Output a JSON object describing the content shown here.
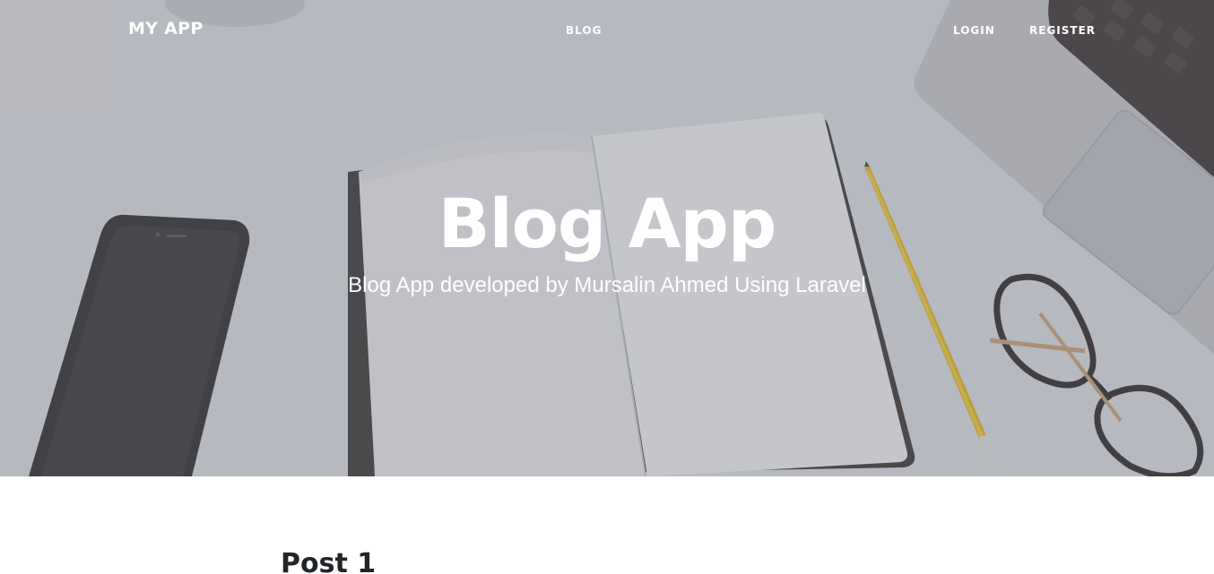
{
  "navbar": {
    "brand": "MY APP",
    "links": [
      {
        "label": "BLOG"
      },
      {
        "label": "LOGIN"
      },
      {
        "label": "REGISTER"
      }
    ]
  },
  "hero": {
    "title": "Blog App",
    "subtitle": "Blog App developed by Mursalin Ahmed Using Laravel"
  },
  "posts": [
    {
      "title": "Post 1"
    }
  ],
  "colors": {
    "overlay": "#6e7078",
    "text_light": "#ffffff",
    "text_dark": "#212529",
    "pencil": "#e5b51c"
  }
}
